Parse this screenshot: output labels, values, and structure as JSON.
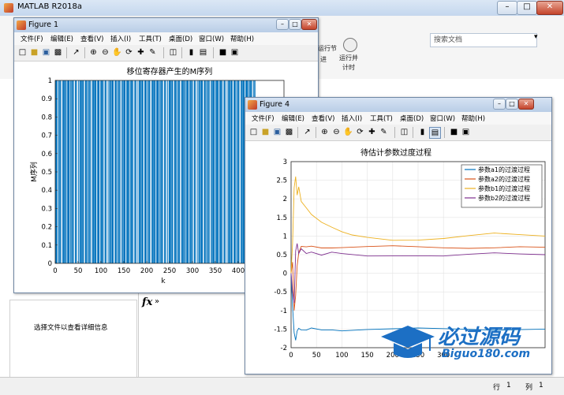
{
  "main": {
    "title": "MATLAB R2018a",
    "search_placeholder": "搜索文档",
    "ribbon_labels": [
      "运行节",
      "进",
      "运行并",
      "计时"
    ],
    "details_text": "选择文件以查看详细信息",
    "cmd_prompt": "fx",
    "cmd_chev": "»",
    "status_row_label": "行",
    "status_row_value": "1",
    "status_col_label": "列",
    "status_col_value": "1"
  },
  "fig1": {
    "title": "Figure 1",
    "menu": [
      "文件(F)",
      "编辑(E)",
      "查看(V)",
      "插入(I)",
      "工具(T)",
      "桌面(D)",
      "窗口(W)",
      "帮助(H)"
    ]
  },
  "fig4": {
    "title": "Figure 4",
    "menu": [
      "文件(F)",
      "编辑(E)",
      "查看(V)",
      "插入(I)",
      "工具(T)",
      "桌面(D)",
      "窗口(W)",
      "帮助(H)"
    ]
  },
  "watermark": {
    "text_cn": "必过源码",
    "text_en": "Biguo180.com"
  },
  "chart_data": [
    {
      "type": "bar",
      "title": "移位寄存器产生的M序列",
      "xlabel": "k",
      "ylabel": "M序列",
      "xlim": [
        0,
        500
      ],
      "ylim": [
        0,
        1
      ],
      "xticks": [
        0,
        50,
        100,
        150,
        200,
        250,
        300,
        350,
        400
      ],
      "yticks": [
        0,
        0.1,
        0.2,
        0.3,
        0.4,
        0.5,
        0.6,
        0.7,
        0.8,
        0.9,
        1
      ],
      "color": "#0072BD",
      "bits": "1110100110110001011011100101111001011011000110100010011101011100011101001101100010111011100101110010110110001101000100111010111000111010011011000101101110010111100101101100011010001001110101110001110100110110001011011100101111001011011000110100010011101011100011101001101100010110111001011110010110110001101000100111010111000111010011011000101101110010111100101101100011010001001110101110001110100110110001011011100101111001011011000110100"
    },
    {
      "type": "line",
      "title": "待估计参数过度过程",
      "xlim": [
        0,
        500
      ],
      "ylim": [
        -2,
        3
      ],
      "xticks": [
        0,
        50,
        100,
        150,
        200,
        250,
        300
      ],
      "yticks": [
        -2,
        -1.5,
        -1,
        -0.5,
        0,
        0.5,
        1,
        1.5,
        2,
        2.5,
        3
      ],
      "grid": true,
      "legend_position": "top-right",
      "series": [
        {
          "name": "参数a1的过渡过程",
          "color": "#0072BD",
          "x": [
            0,
            3,
            6,
            9,
            12,
            15,
            20,
            30,
            40,
            60,
            80,
            100,
            150,
            200,
            250,
            300,
            350,
            400,
            450,
            500
          ],
          "y": [
            0,
            -0.9,
            -1.6,
            -1.8,
            -1.55,
            -1.45,
            -1.52,
            -1.55,
            -1.5,
            -1.53,
            -1.5,
            -1.52,
            -1.5,
            -1.51,
            -1.5,
            -1.5,
            -1.49,
            -1.5,
            -1.5,
            -1.5
          ]
        },
        {
          "name": "参数a2的过渡过程",
          "color": "#D95319",
          "x": [
            0,
            3,
            6,
            9,
            12,
            15,
            20,
            30,
            40,
            60,
            80,
            100,
            150,
            200,
            250,
            300,
            350,
            400,
            450,
            500
          ],
          "y": [
            0,
            0.3,
            -1.0,
            -0.6,
            0.2,
            0.55,
            0.7,
            0.68,
            0.72,
            0.7,
            0.71,
            0.7,
            0.7,
            0.71,
            0.7,
            0.7,
            0.7,
            0.7,
            0.7,
            0.7
          ]
        },
        {
          "name": "参数b1的过渡过程",
          "color": "#EDB120",
          "x": [
            0,
            3,
            6,
            9,
            12,
            15,
            20,
            30,
            40,
            60,
            80,
            100,
            120,
            150,
            200,
            250,
            300,
            350,
            400,
            450,
            500
          ],
          "y": [
            0,
            0.8,
            2.3,
            2.6,
            2.1,
            2.3,
            1.9,
            1.75,
            1.6,
            1.4,
            1.25,
            1.1,
            1.0,
            0.95,
            0.9,
            0.92,
            0.95,
            1.0,
            1.05,
            1.02,
            1.0
          ]
        },
        {
          "name": "参数b2的过渡过程",
          "color": "#7E2F8E",
          "x": [
            0,
            3,
            6,
            9,
            12,
            15,
            20,
            30,
            40,
            60,
            80,
            100,
            150,
            200,
            250,
            300,
            350,
            400,
            450,
            500
          ],
          "y": [
            0,
            -0.5,
            -0.8,
            0.6,
            0.8,
            0.5,
            0.65,
            0.55,
            0.6,
            0.5,
            0.55,
            0.5,
            0.45,
            0.48,
            0.5,
            0.48,
            0.5,
            0.52,
            0.5,
            0.5
          ]
        }
      ]
    }
  ]
}
